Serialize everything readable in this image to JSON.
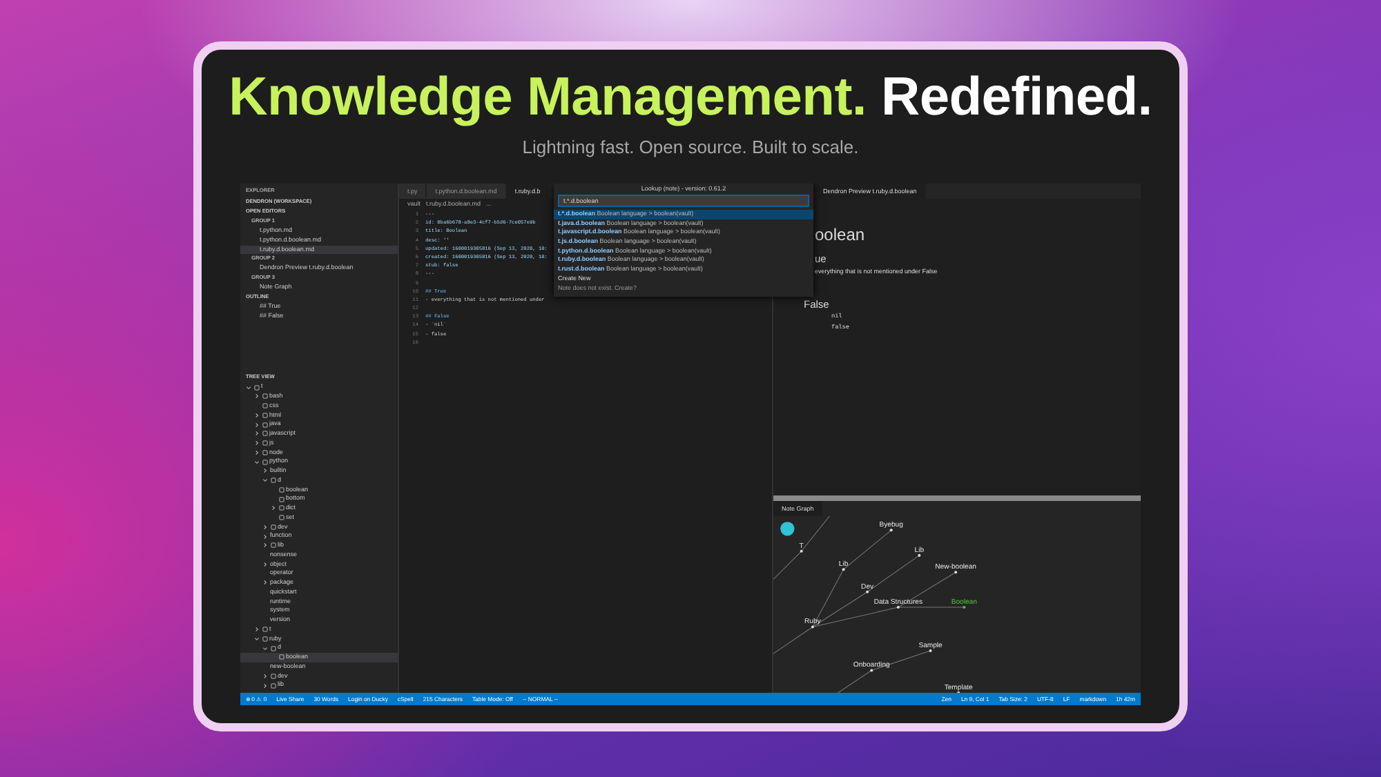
{
  "hero": {
    "headline": [
      {
        "text": "Knowledge Management.",
        "color": "#c8f25c"
      },
      {
        "text": "Redefined.",
        "color": "#ffffff"
      }
    ],
    "subtitle": "Lightning fast. Open source. Built to scale."
  },
  "sidebar": {
    "title": "EXPLORER",
    "workspace": "DENDRON (WORKSPACE)",
    "open_editors": {
      "title": "OPEN EDITORS",
      "groups": [
        {
          "title": "GROUP 1",
          "items": [
            {
              "label": "t.python.md",
              "selected": false
            },
            {
              "label": "t.python.d.boolean.md",
              "selected": false
            },
            {
              "label": "t.ruby.d.boolean.md",
              "selected": true
            }
          ]
        },
        {
          "title": "GROUP 2",
          "items": [
            {
              "label": "Dendron Preview t.ruby.d.boolean",
              "selected": false
            }
          ]
        },
        {
          "title": "GROUP 3",
          "items": [
            {
              "label": "Note Graph",
              "selected": false
            }
          ]
        }
      ]
    },
    "outline": {
      "title": "OUTLINE",
      "items": [
        "## True",
        "## False"
      ]
    },
    "tree_view": {
      "title": "TREE VIEW",
      "items": [
        {
          "label": "t",
          "kind": "file",
          "expanded": true,
          "selected": false,
          "children": [
            {
              "label": "bash",
              "kind": "file",
              "expanded": false,
              "selected": false
            },
            {
              "label": "css",
              "kind": "file",
              "selected": false
            },
            {
              "label": "html",
              "kind": "file",
              "expanded": false,
              "selected": false
            },
            {
              "label": "java",
              "kind": "file",
              "expanded": false,
              "selected": false
            },
            {
              "label": "javascript",
              "kind": "file",
              "expanded": false,
              "selected": false
            },
            {
              "label": "js",
              "kind": "file",
              "expanded": false,
              "selected": false
            },
            {
              "label": "node",
              "kind": "file",
              "expanded": false,
              "selected": false
            },
            {
              "label": "python",
              "kind": "file",
              "expanded": true,
              "selected": false,
              "children": [
                {
                  "label": "builtin",
                  "kind": "stub",
                  "expanded": false,
                  "selected": false
                },
                {
                  "label": "d",
                  "kind": "file",
                  "expanded": true,
                  "selected": false,
                  "children": [
                    {
                      "label": "boolean",
                      "kind": "file",
                      "selected": false
                    },
                    {
                      "label": "bottom",
                      "kind": "file",
                      "selected": false
                    },
                    {
                      "label": "dict",
                      "kind": "file",
                      "expanded": false,
                      "selected": false
                    },
                    {
                      "label": "set",
                      "kind": "file",
                      "selected": false
                    }
                  ]
                },
                {
                  "label": "dev",
                  "kind": "file",
                  "expanded": false,
                  "selected": false
                },
                {
                  "label": "function",
                  "kind": "stub",
                  "expanded": false,
                  "selected": false
                },
                {
                  "label": "lib",
                  "kind": "file",
                  "expanded": false,
                  "selected": false
                },
                {
                  "label": "nonsense",
                  "kind": "stub",
                  "selected": false
                },
                {
                  "label": "object",
                  "kind": "stub",
                  "expanded": false,
                  "selected": false
                },
                {
                  "label": "operator",
                  "kind": "stub",
                  "selected": false
                },
                {
                  "label": "package",
                  "kind": "stub",
                  "expanded": false,
                  "selected": false
                },
                {
                  "label": "quickstart",
                  "kind": "stub",
                  "selected": false
                },
                {
                  "label": "runtime",
                  "kind": "stub",
                  "selected": false
                },
                {
                  "label": "system",
                  "kind": "stub",
                  "selected": false
                },
                {
                  "label": "version",
                  "kind": "stub",
                  "selected": false
                }
              ]
            },
            {
              "label": "t",
              "kind": "file",
              "expanded": false,
              "selected": false
            },
            {
              "label": "ruby",
              "kind": "file",
              "expanded": true,
              "selected": false,
              "children": [
                {
                  "label": "d",
                  "kind": "file",
                  "expanded": true,
                  "selected": false,
                  "children": [
                    {
                      "label": "boolean",
                      "kind": "file",
                      "selected": true
                    }
                  ]
                },
                {
                  "label": "new-boolean",
                  "kind": "stub",
                  "selected": false
                },
                {
                  "label": "dev",
                  "kind": "file",
                  "expanded": false,
                  "selected": false
                },
                {
                  "label": "lib",
                  "kind": "file",
                  "expanded": false,
                  "selected": false
                }
              ]
            }
          ]
        }
      ]
    }
  },
  "editor": {
    "tabs": [
      {
        "label": "t.py",
        "selected": false
      },
      {
        "label": "t.python.d.boolean.md",
        "selected": false
      },
      {
        "label": "t.ruby.d.b",
        "selected": true
      }
    ],
    "breadcrumb": [
      "vault",
      "t.ruby.d.boolean.md",
      "..."
    ],
    "lines": [
      {
        "number": "1",
        "text": "---",
        "kind": "meta"
      },
      {
        "number": "2",
        "text": "id: 0ba6b678-a8e3-4cf7-b5d6-7ce057e9b",
        "kind": "meta"
      },
      {
        "number": "3",
        "text": "title: Boolean",
        "kind": "meta"
      },
      {
        "number": "4",
        "text": "desc: ''",
        "kind": "meta"
      },
      {
        "number": "5",
        "text": "updated: 1600019305816 (Sep 13, 2020, 10:",
        "kind": "meta"
      },
      {
        "number": "6",
        "text": "created: 1600019305816 (Sep 13, 2020, 10:",
        "kind": "meta"
      },
      {
        "number": "7",
        "text": "stub: false",
        "kind": "meta"
      },
      {
        "number": "8",
        "text": "---",
        "kind": "meta"
      },
      {
        "number": "9"
      },
      {
        "number": "10",
        "text": "## True",
        "kind": "heading"
      },
      {
        "number": "11",
        "text": "- everything that is not mentioned under",
        "kind": "text"
      },
      {
        "number": "12"
      },
      {
        "number": "13",
        "text": "## False",
        "kind": "heading"
      },
      {
        "number": "14",
        "text": "- `nil`",
        "kind": "text"
      },
      {
        "number": "15",
        "text": "- false",
        "kind": "text"
      },
      {
        "number": "16"
      }
    ]
  },
  "lookup": {
    "title": "Lookup (note) - version: 0.61.2",
    "value": "t.*.d.boolean",
    "results": [
      {
        "name": "t.*.d.boolean",
        "title": "Boolean",
        "path": "language > boolean(vault)",
        "selected": true
      },
      {
        "name": "t.java.d.boolean",
        "title": "Boolean",
        "path": "language > boolean(vault)",
        "selected": false
      },
      {
        "name": "t.javascript.d.boolean",
        "title": "Boolean",
        "path": "language > boolean(vault)",
        "selected": false
      },
      {
        "name": "t.js.d.boolean",
        "title": "Boolean",
        "path": "language > boolean(vault)",
        "selected": false
      },
      {
        "name": "t.python.d.boolean",
        "title": "Boolean",
        "path": "language > boolean(vault)",
        "selected": false
      },
      {
        "name": "t.ruby.d.boolean",
        "title": "Boolean",
        "path": "language > boolean(vault)",
        "selected": false
      },
      {
        "name": "t.rust.d.boolean",
        "title": "Boolean",
        "path": "language > boolean(vault)",
        "selected": false
      }
    ],
    "create": "Create New",
    "hint": "Note does not exist. Create?"
  },
  "preview": {
    "tab": "Dendron Preview t.ruby.d.boolean",
    "title": "oolean",
    "sections": [
      {
        "heading": "ue",
        "items": [
          "everything that is not mentioned under False"
        ],
        "kind": "text"
      },
      {
        "heading": "False",
        "items": [
          "nil",
          "false"
        ],
        "kind": "list"
      }
    ]
  },
  "graph": {
    "tab": "Note Graph",
    "nodes": [
      {
        "label": "Byebug",
        "selected": false
      },
      {
        "label": "T",
        "selected": false
      },
      {
        "label": "Lib",
        "selected": false
      },
      {
        "label": "Dev",
        "selected": false
      },
      {
        "label": "Lib",
        "selected": false
      },
      {
        "label": "New-boolean",
        "selected": false
      },
      {
        "label": "Data Structures",
        "selected": false
      },
      {
        "label": "Boolean",
        "selected": true
      },
      {
        "label": "Ruby",
        "selected": false
      },
      {
        "label": "Sample",
        "selected": false
      },
      {
        "label": "Onboarding",
        "selected": false
      },
      {
        "label": "Template",
        "selected": false
      }
    ]
  },
  "status_bar": {
    "left": [
      "⊗ 0 ⚠ 0",
      "Live Share",
      "30 Words",
      "Login on Ducky",
      "cSpell",
      "215 Characters",
      "Table Mode: Off",
      "-- NORMAL --"
    ],
    "right": [
      "Zen",
      "Ln 9, Col 1",
      "Tab Size: 2",
      "UTF-8",
      "LF",
      "markdown",
      "1h 42m"
    ]
  }
}
